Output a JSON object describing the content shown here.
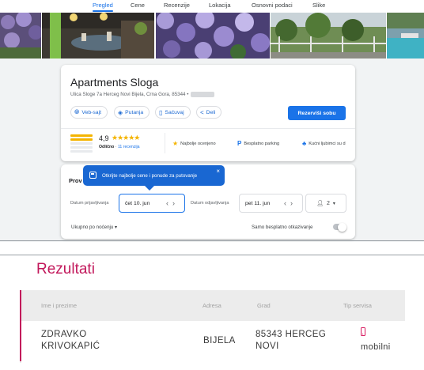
{
  "tabs": [
    {
      "label": "Pregled",
      "active": true
    },
    {
      "label": "Cene",
      "active": false
    },
    {
      "label": "Recenzije",
      "active": false
    },
    {
      "label": "Lokacija",
      "active": false
    },
    {
      "label": "Osnovni podaci",
      "active": false
    },
    {
      "label": "Slike",
      "active": false
    }
  ],
  "hotel": {
    "name": "Apartments Sloga",
    "address": "Ulica Sloge 7a Herceg Novi Bijela, Crna Gora, 85344 •",
    "actions": [
      {
        "label": "Veb-sajt",
        "icon": "globe-icon"
      },
      {
        "label": "Putanja",
        "icon": "directions-icon"
      },
      {
        "label": "Sačuvaj",
        "icon": "bookmark-icon"
      },
      {
        "label": "Deli",
        "icon": "share-icon"
      }
    ],
    "book_label": "Rezerviši sobu",
    "rating": {
      "value": "4,9",
      "stars": "★★★★★",
      "label": "Odlično",
      "reviews": "11 recenzija"
    },
    "amenities": [
      {
        "label": "Najbolje ocenjeno",
        "icon": "star-icon"
      },
      {
        "label": "Besplatno parking",
        "icon": "parking-icon"
      },
      {
        "label": "Kućni ljubimci su d",
        "icon": "pets-icon"
      }
    ]
  },
  "prices": {
    "heading": "Prov",
    "tooltip": "Otkrijte najbolje cene i ponude za putovanje",
    "checkin_label": "Datum prijavljivanja",
    "checkin_value": "čet 10. jun",
    "checkout_label": "Datum odjavljivanja",
    "checkout_value": "pet 11. jun",
    "guests": "2",
    "sort_label": "Ukupno po noćenju ▾",
    "free_cancel_label": "Samo besplatno otkazivanje",
    "free_cancel_on": false
  },
  "results": {
    "title": "Rezultati",
    "columns": [
      "Ime i prezime",
      "Adresa",
      "Grad",
      "Tip servisa"
    ],
    "rows": [
      {
        "name": "ZDRAVKO KRIVOKAPIĆ",
        "address": "BIJELA",
        "city": "85343 HERCEG NOVI",
        "service": "mobilni",
        "service_icon": "mobile-phone-icon"
      }
    ]
  },
  "colors": {
    "google_blue": "#1a73e8",
    "accent_magenta": "#c2185b",
    "star_yellow": "#f4b400"
  }
}
